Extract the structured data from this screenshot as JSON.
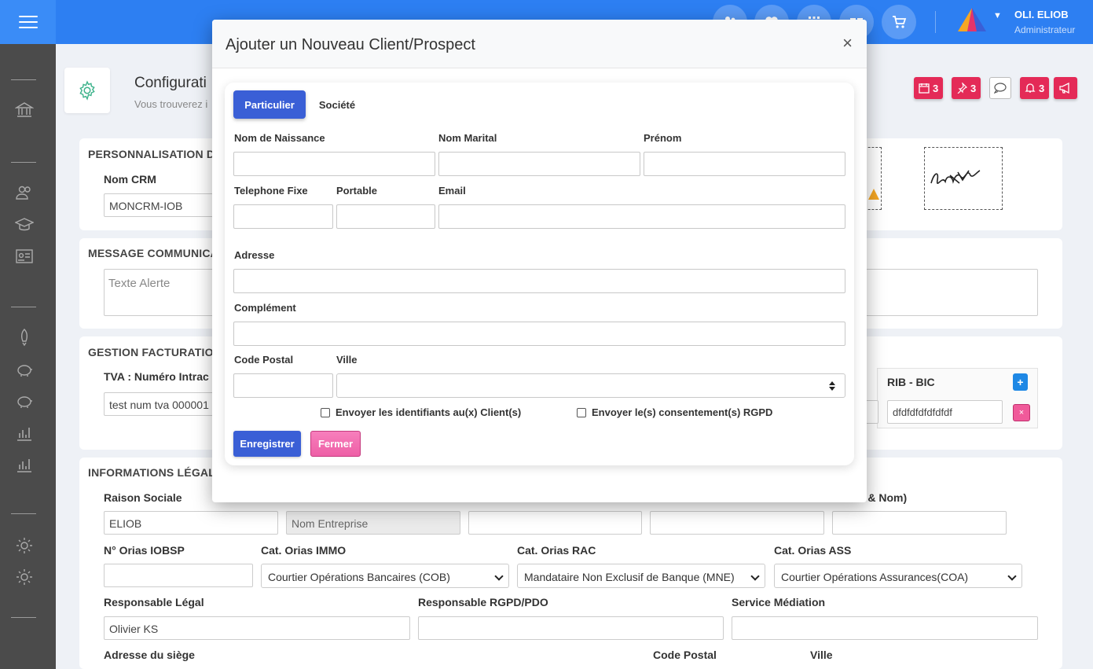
{
  "topbar": {
    "user_name": "OLI. ELIOB",
    "user_role": "Administrateur",
    "icons": [
      "people-icon",
      "heart-icon",
      "grid-icon",
      "gift-icon",
      "cart-icon"
    ]
  },
  "page": {
    "title": "Configurati",
    "subtitle": "Vous trouverez i",
    "badges": {
      "calendar": "3",
      "pin": "3",
      "bell": "3"
    }
  },
  "perso": {
    "title": "PERSONNALISATION DU",
    "nom_crm_label": "Nom CRM",
    "nom_crm_value": "MONCRM-IOB"
  },
  "message": {
    "title": "MESSAGE COMMUNICA",
    "alert_placeholder": "Texte Alerte"
  },
  "facturation": {
    "title": "GESTION FACTURATION",
    "tva_label": "TVA : Numéro Intrac",
    "tva_value": "test num tva 000001",
    "rib_label": "RIB - BIC",
    "rib_value": "dfdfdfdfdfdfdf",
    "add_label": "+",
    "remove_label": "×"
  },
  "legal": {
    "title": "INFORMATIONS LÉGALE",
    "raison_label": "Raison Sociale",
    "raison_value": "ELIOB",
    "entreprise_placeholder": "Nom Entreprise",
    "partial_label": "l° & Nom)",
    "orias_iobsp_label": "N° Orias IOBSP",
    "immo_label": "Cat. Orias IMMO",
    "immo_value": "Courtier Opérations Bancaires (COB)",
    "rac_label": "Cat. Orias RAC",
    "rac_value": "Mandataire Non Exclusif de Banque (MNE)",
    "ass_label": "Cat. Orias ASS",
    "ass_value": "Courtier Opérations Assurances(COA)",
    "resp_legal_label": "Responsable Légal",
    "resp_legal_value": "Olivier KS",
    "rgpd_label": "Responsable RGPD/PDO",
    "mediation_label": "Service Médiation",
    "siege_label": "Adresse du siège",
    "cp_label": "Code Postal",
    "ville_label": "Ville"
  },
  "modal": {
    "title": "Ajouter un Nouveau Client/Prospect",
    "close": "×",
    "tabs": [
      "Particulier",
      "Société"
    ],
    "labels": {
      "nom_naissance": "Nom de Naissance",
      "nom_marital": "Nom Marital",
      "prenom": "Prénom",
      "tel_fixe": "Telephone Fixe",
      "portable": "Portable",
      "email": "Email",
      "adresse": "Adresse",
      "complement": "Complément",
      "code_postal": "Code Postal",
      "ville": "Ville"
    },
    "check_identifiants": "Envoyer les identifiants au(x) Client(s)",
    "check_rgpd": "Envoyer le(s) consentement(s) RGPD",
    "save": "Enregistrer",
    "close_btn": "Fermer"
  },
  "colors": {
    "topbar": "#2d7ff2",
    "sidebar": "#4b4b4b",
    "primary": "#3a5fd6",
    "danger": "#e42a57",
    "pink": "#f06fb0"
  }
}
